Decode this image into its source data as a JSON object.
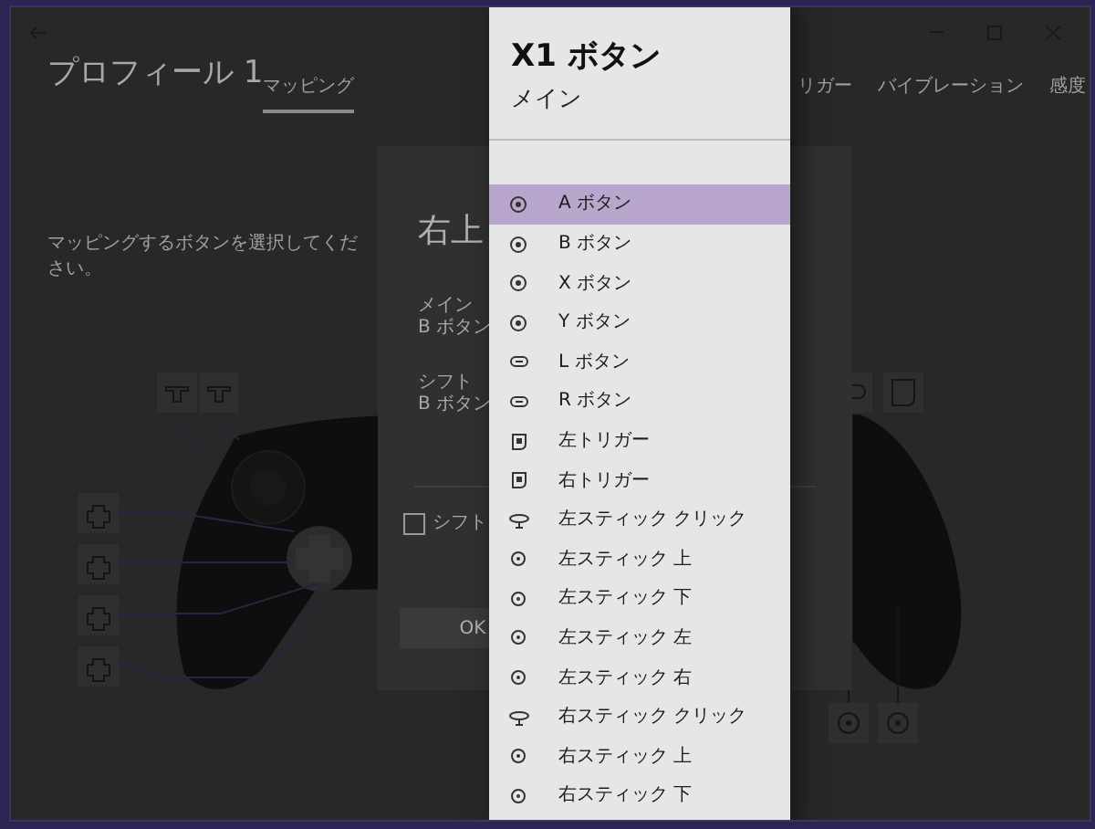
{
  "profile_title": "プロフィール 1",
  "tabs": [
    {
      "label": "マッピング",
      "selected": true
    },
    {
      "label": "リガー",
      "selected": false
    },
    {
      "label": "バイブレーション",
      "selected": false
    },
    {
      "label": "感度",
      "selected": false
    }
  ],
  "instruction": "マッピングするボタンを選択してください。",
  "dialog": {
    "title": "右上",
    "fields": [
      {
        "label": "メイン",
        "value": "B ボタン"
      },
      {
        "label": "シフト",
        "value": "B ボタン"
      }
    ],
    "checkbox": {
      "label": "シフト",
      "checked": false
    },
    "ok_button": "OK"
  },
  "menu": {
    "title": "X1 ボタン",
    "subtitle": "メイン",
    "items": [
      {
        "label": "A ボタン",
        "kind": "face",
        "selected": true
      },
      {
        "label": "B ボタン",
        "kind": "face",
        "selected": false
      },
      {
        "label": "X ボタン",
        "kind": "face",
        "selected": false
      },
      {
        "label": "Y ボタン",
        "kind": "face",
        "selected": false
      },
      {
        "label": "L ボタン",
        "kind": "bumper",
        "selected": false
      },
      {
        "label": "R ボタン",
        "kind": "bumper",
        "selected": false
      },
      {
        "label": "左トリガー",
        "kind": "trigger",
        "selected": false
      },
      {
        "label": "右トリガー",
        "kind": "trigger",
        "selected": false
      },
      {
        "label": "左スティック クリック",
        "kind": "click",
        "selected": false
      },
      {
        "label": "左スティック 上",
        "kind": "stick",
        "selected": false
      },
      {
        "label": "左スティック 下",
        "kind": "stick",
        "selected": false
      },
      {
        "label": "左スティック 左",
        "kind": "stick",
        "selected": false
      },
      {
        "label": "左スティック 右",
        "kind": "stick",
        "selected": false
      },
      {
        "label": "右スティック クリック",
        "kind": "click",
        "selected": false
      },
      {
        "label": "右スティック 上",
        "kind": "stick",
        "selected": false
      },
      {
        "label": "右スティック 下",
        "kind": "stick",
        "selected": false
      }
    ]
  }
}
